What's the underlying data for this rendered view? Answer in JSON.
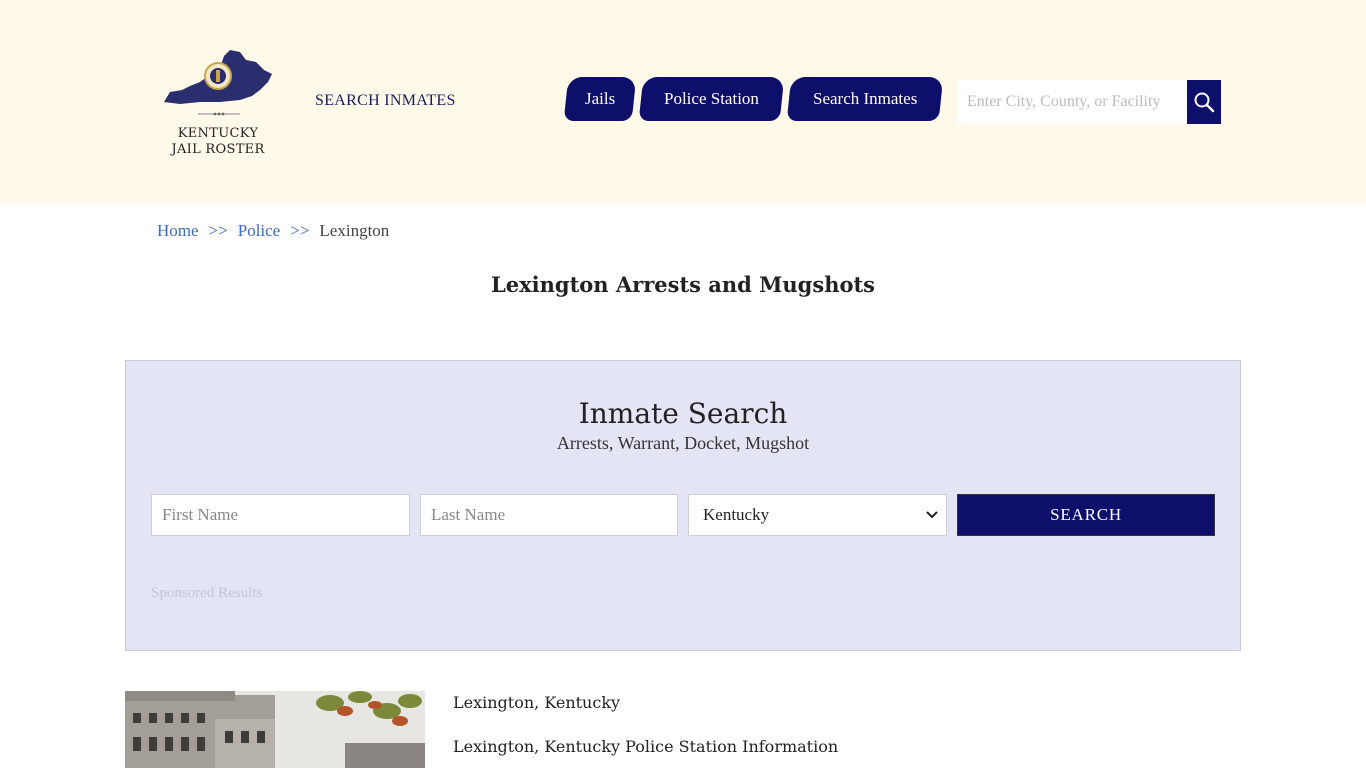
{
  "header": {
    "logo_lines": [
      "KENTUCKY",
      "JAIL ROSTER"
    ],
    "top_link": "SEARCH INMATES",
    "nav": [
      {
        "label": "Jails"
      },
      {
        "label": "Police Station"
      },
      {
        "label": "Search Inmates"
      }
    ],
    "search_placeholder": "Enter City, County, or Facility"
  },
  "breadcrumb": {
    "home": "Home",
    "sep": ">>",
    "police": "Police",
    "current": "Lexington"
  },
  "page_title": "Lexington Arrests and Mugshots",
  "inmate_search": {
    "title": "Inmate Search",
    "subtitle": "Arrests, Warrant, Docket, Mugshot",
    "first_placeholder": "First Name",
    "last_placeholder": "Last Name",
    "state_selected": "Kentucky",
    "submit_label": "SEARCH",
    "sponsored": "Sponsored Results"
  },
  "info": {
    "line1": "Lexington, Kentucky",
    "line2": "Lexington, Kentucky Police Station Information"
  },
  "colors": {
    "navy": "#0e0e6b",
    "header_bg": "#fff9ea",
    "panel_bg": "#e3e5f5",
    "link": "#3b69c4"
  }
}
